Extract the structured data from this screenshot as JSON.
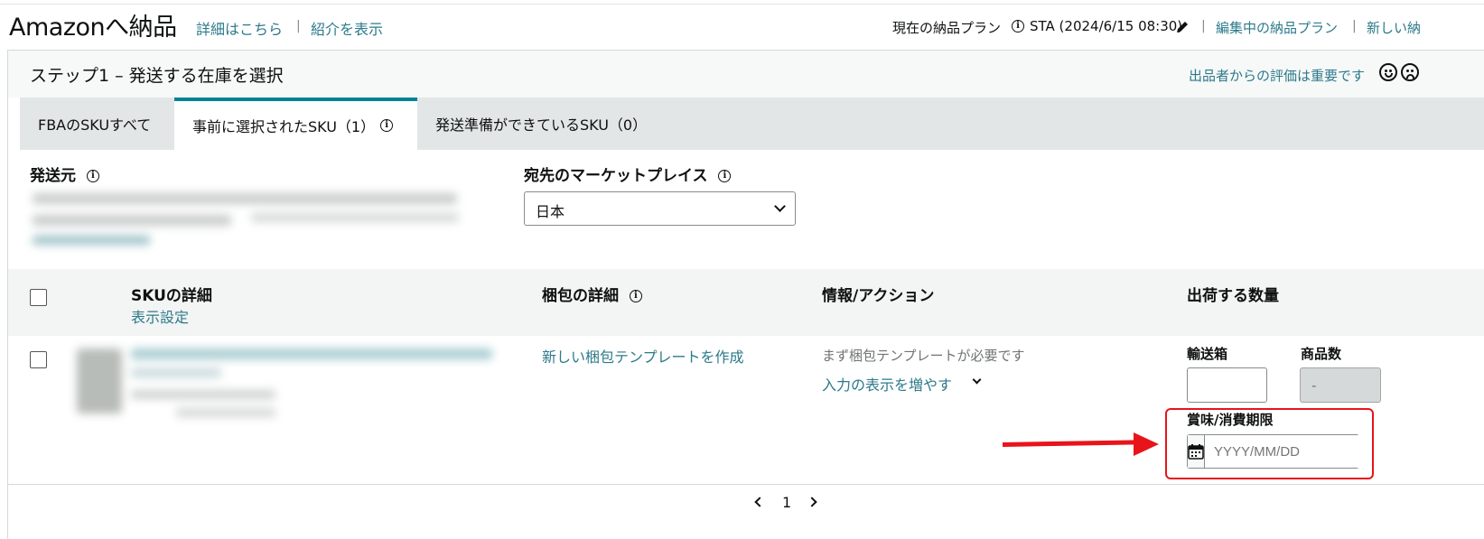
{
  "header": {
    "title": "Amazonへ納品",
    "details_link": "詳細はこちら",
    "intro_link": "紹介を表示",
    "current_plan_label": "現在の納品プラン",
    "current_plan_value": "STA (2024/6/15 08:30)",
    "editing_plan_link": "編集中の納品プラン",
    "new_plan_link": "新しい納"
  },
  "step": {
    "title": "ステップ1 – 発送する在庫を選択",
    "feedback_text": "出品者からの評価は重要です"
  },
  "tabs": [
    {
      "label": "FBAのSKUすべて",
      "active": false
    },
    {
      "label": "事前に選択されたSKU（1）",
      "active": true
    },
    {
      "label": "発送準備ができているSKU（0）",
      "active": false
    }
  ],
  "ship_from": {
    "label": "発送元"
  },
  "marketplace": {
    "label": "宛先のマーケットプレイス",
    "selected": "日本"
  },
  "table": {
    "headers": {
      "sku": "SKUの詳細",
      "display_settings": "表示設定",
      "packing": "梱包の詳細",
      "info": "情報/アクション",
      "quantity": "出荷する数量"
    },
    "row": {
      "packing_link": "新しい梱包テンプレートを作成",
      "info_note": "まず梱包テンプレートが必要です",
      "more_inputs": "入力の表示を増やす",
      "boxes_label": "輸送箱",
      "units_label": "商品数",
      "units_value": "-",
      "expiry_label": "賞味/消費期限",
      "expiry_placeholder": "YYYY/MM/DD"
    }
  },
  "pagination": {
    "current_page": "1"
  },
  "colors": {
    "link": "#2c7a8a",
    "active_tab": "#008296",
    "annotation": "#e8141a"
  }
}
